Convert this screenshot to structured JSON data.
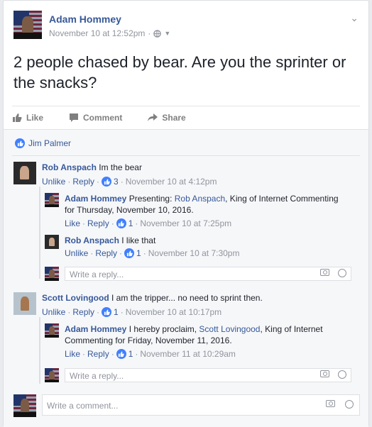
{
  "post": {
    "author": "Adam Hommey",
    "timestamp": "November 10 at 12:52pm",
    "privacy_icon": "globe-icon",
    "text": "2 people chased by bear. Are you the sprinter or the snacks?",
    "actions": {
      "like": "Like",
      "comment": "Comment",
      "share": "Share"
    }
  },
  "likers": "Jim Palmer",
  "comments": [
    {
      "author": "Rob Anspach",
      "text": "Im the bear",
      "action": "Unlike",
      "reply": "Reply",
      "likes": "3",
      "time": "November 10 at 4:12pm",
      "replies": [
        {
          "author": "Adam Hommey",
          "text_before": "Presenting: ",
          "mention": "Rob Anspach",
          "text_after": ", King of Internet Commenting for Thursday, November 10, 2016.",
          "action": "Like",
          "reply": "Reply",
          "likes": "1",
          "time": "November 10 at 7:25pm"
        },
        {
          "author": "Rob Anspach",
          "text": "I like that",
          "action": "Unlike",
          "reply": "Reply",
          "likes": "1",
          "time": "November 10 at 7:30pm"
        }
      ],
      "reply_placeholder": "Write a reply..."
    },
    {
      "author": "Scott Lovingood",
      "text": "I am the tripper... no need to sprint then.",
      "action": "Unlike",
      "reply": "Reply",
      "likes": "1",
      "time": "November 10 at 10:17pm",
      "replies": [
        {
          "author": "Adam Hommey",
          "text_before": "I hereby proclaim, ",
          "mention": "Scott Lovingood",
          "text_after": ", King of Internet Commenting for Friday, November 11, 2016.",
          "action": "Like",
          "reply": "Reply",
          "likes": "1",
          "time": "November 11 at 10:29am"
        }
      ],
      "reply_placeholder": "Write a reply..."
    }
  ],
  "comment_placeholder": "Write a comment...",
  "colors": {
    "link": "#365899",
    "like_blue": "#4080ff",
    "muted": "#90949c"
  }
}
